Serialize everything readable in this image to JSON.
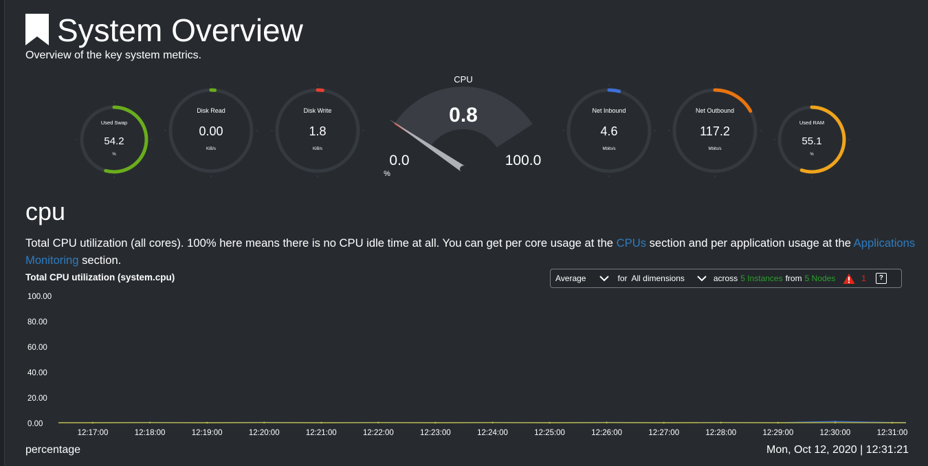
{
  "header": {
    "title": "System Overview",
    "subtitle": "Overview of the key system metrics.",
    "icon": "bookmark-icon"
  },
  "gauges": [
    {
      "id": "used-swap",
      "label": "Used Swap",
      "value": "54.2",
      "unit": "%",
      "fraction": 0.542,
      "color": "#6aad1c",
      "size": "small"
    },
    {
      "id": "disk-read",
      "label": "Disk Read",
      "value": "0.00",
      "unit": "KiB/s",
      "fraction": 0.0,
      "color": "#6aad1c",
      "size": "medium"
    },
    {
      "id": "disk-write",
      "label": "Disk Write",
      "value": "1.8",
      "unit": "KiB/s",
      "fraction": 0.02,
      "color": "#e8402f",
      "size": "medium"
    },
    {
      "id": "net-inbound",
      "label": "Net Inbound",
      "value": "4.6",
      "unit": "Mbits/s",
      "fraction": 0.04,
      "color": "#3e6fd7",
      "size": "medium"
    },
    {
      "id": "net-outbound",
      "label": "Net Outbound",
      "value": "117.2",
      "unit": "Mbits/s",
      "fraction": 0.17,
      "color": "#e8740e",
      "size": "medium"
    },
    {
      "id": "used-ram",
      "label": "Used RAM",
      "value": "55.1",
      "unit": "%",
      "fraction": 0.551,
      "color": "#f0a41c",
      "size": "small"
    }
  ],
  "cpu_gauge": {
    "title": "CPU",
    "value": "0.8",
    "min": "0.0",
    "max": "100.0",
    "unit": "%",
    "fraction": 0.008
  },
  "section": {
    "title": "cpu",
    "description_1": "Total CPU utilization (all cores). 100% here means there is no CPU idle time at all. You can get per core usage at the ",
    "link_cpus": "CPUs",
    "description_2": " section and per application usage at the ",
    "link_apps": "Applications Monitoring",
    "description_3": " section."
  },
  "chart_controls": {
    "aggregation": "Average",
    "for_label": "for",
    "dimensions": "All dimensions",
    "across_label": "across",
    "instances": "5 Instances",
    "from_label": "from",
    "nodes": "5 Nodes",
    "alert_count": "1",
    "help": "?"
  },
  "chart_data": {
    "type": "line",
    "title": "Total CPU utilization (system.cpu)",
    "ylabel": "percentage",
    "ylim": [
      0,
      100
    ],
    "yticks": [
      "100.00",
      "80.00",
      "60.00",
      "40.00",
      "20.00",
      "0.00"
    ],
    "xticks": [
      "12:17:00",
      "12:18:00",
      "12:19:00",
      "12:20:00",
      "12:21:00",
      "12:22:00",
      "12:23:00",
      "12:24:00",
      "12:25:00",
      "12:26:00",
      "12:27:00",
      "12:28:00",
      "12:29:00",
      "12:30:00",
      "12:31:00"
    ],
    "series": [
      {
        "color": "#3e6fd7",
        "values": [
          0.6,
          0.7,
          0.6,
          0.8,
          0.6,
          0.7,
          0.6,
          0.7,
          0.6,
          0.8,
          0.6,
          0.7,
          0.6,
          1.5,
          0.7
        ]
      },
      {
        "color": "#c9c33a",
        "values": [
          0.5,
          0.6,
          0.5,
          0.6,
          0.5,
          0.6,
          0.5,
          0.6,
          0.5,
          0.6,
          0.5,
          0.6,
          0.5,
          0.6,
          0.5
        ]
      }
    ]
  },
  "footer": {
    "units": "percentage",
    "datetime": "Mon, Oct 12, 2020 | 12:31:21"
  }
}
